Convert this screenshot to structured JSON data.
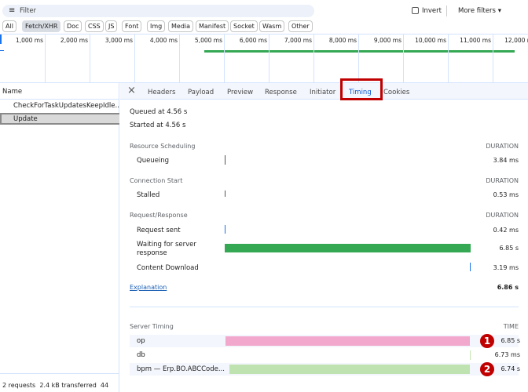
{
  "toolbar": {
    "filter_placeholder": "Filter",
    "invert_label": "Invert",
    "more_filters_label": "More filters"
  },
  "type_filters": [
    "All",
    "Fetch/XHR",
    "Doc",
    "CSS",
    "JS",
    "Font",
    "Img",
    "Media",
    "Manifest",
    "Socket",
    "Wasm",
    "Other"
  ],
  "active_filter": "Fetch/XHR",
  "timeline": {
    "ticks": [
      "1,000 ms",
      "2,000 ms",
      "3,000 ms",
      "4,000 ms",
      "5,000 ms",
      "6,000 ms",
      "7,000 ms",
      "8,000 ms",
      "9,000 ms",
      "10,000 ms",
      "11,000 ms",
      "12,000 ms"
    ],
    "bar_color": "#34a853"
  },
  "requests": {
    "header": "Name",
    "items": [
      "CheckForTaskUpdatesKeepIdle...",
      "Update"
    ],
    "selected": 1
  },
  "tabs": [
    "Headers",
    "Payload",
    "Preview",
    "Response",
    "Initiator",
    "Timing",
    "Cookies"
  ],
  "active_tab": "Timing",
  "timing": {
    "queued": "Queued at 4.56 s",
    "started": "Started at 4.56 s",
    "duration_header": "DURATION",
    "sections": [
      {
        "title": "Resource Scheduling",
        "rows": [
          {
            "label": "Queueing",
            "value": "3.84 ms"
          }
        ]
      },
      {
        "title": "Connection Start",
        "rows": [
          {
            "label": "Stalled",
            "value": "0.53 ms"
          }
        ]
      },
      {
        "title": "Request/Response",
        "rows": [
          {
            "label": "Request sent",
            "value": "0.42 ms"
          },
          {
            "label": "Waiting for server response",
            "value": "6.85 s"
          },
          {
            "label": "Content Download",
            "value": "3.19 ms"
          }
        ]
      }
    ],
    "explanation": "Explanation",
    "total": "6.86 s"
  },
  "server_timing": {
    "title": "Server Timing",
    "time_header": "TIME",
    "rows": [
      {
        "label": "op",
        "value": "6.85 s",
        "color": "#f2a7cc",
        "badge": "1"
      },
      {
        "label": "db",
        "value": "6.73 ms",
        "color": "#c6e5b3",
        "badge": ""
      },
      {
        "label": "bpm — Erp.BO.ABCCode...",
        "value": "6.74 s",
        "color": "#bfe3b0",
        "badge": "2"
      }
    ]
  },
  "status": {
    "requests": "2 requests",
    "transferred": "2.4 kB transferred",
    "extra": "44"
  }
}
